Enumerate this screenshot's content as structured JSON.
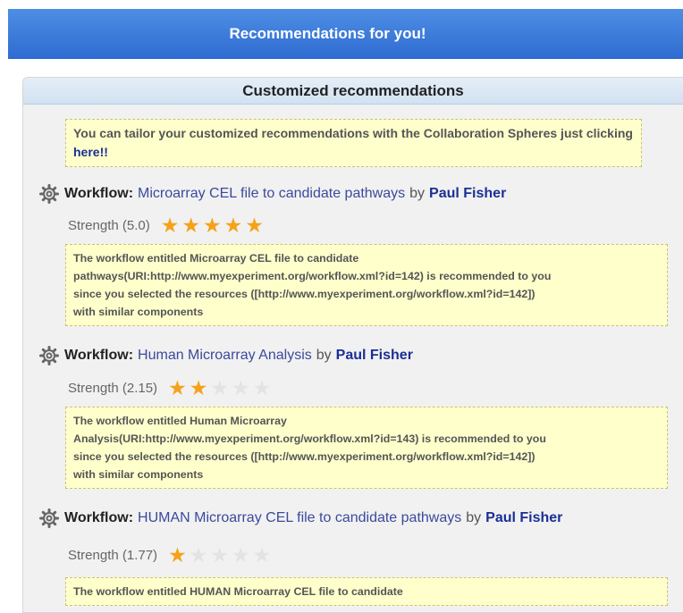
{
  "header": {
    "title": "Recommendations for you!"
  },
  "panel": {
    "title": "Customized recommendations",
    "note": {
      "text": "You can tailor your customized recommendations with the Collaboration Spheres just clicking ",
      "link": "here!!"
    }
  },
  "recommendations": [
    {
      "label": "Workflow:",
      "title": "Microarray CEL file to candidate pathways",
      "by": "by",
      "author": "Paul Fisher",
      "strength_text": "Strength (5.0)",
      "rating": 5,
      "max_rating": 5,
      "description_lines": [
        "The workflow entitled Microarray CEL file to candidate",
        "pathways(URI:http://www.myexperiment.org/workflow.xml?id=142) is recommended to you",
        "since you selected the resources ([http://www.myexperiment.org/workflow.xml?id=142])",
        "with similar components"
      ]
    },
    {
      "label": "Workflow:",
      "title": "Human Microarray Analysis",
      "by": "by",
      "author": "Paul Fisher",
      "strength_text": "Strength (2.15)",
      "rating": 2,
      "max_rating": 5,
      "description_lines": [
        "The workflow entitled Human Microarray",
        "Analysis(URI:http://www.myexperiment.org/workflow.xml?id=143) is recommended to you",
        "since you selected the resources ([http://www.myexperiment.org/workflow.xml?id=142])",
        "with similar components"
      ]
    },
    {
      "label": "Workflow:",
      "title": "HUMAN Microarray CEL file to candidate pathways",
      "by": "by",
      "author": "Paul Fisher",
      "strength_text": "Strength (1.77)",
      "rating": 1,
      "max_rating": 5,
      "description_lines": [
        "The workflow entitled HUMAN Microarray CEL file to candidate"
      ]
    }
  ],
  "icons": {
    "workflow": "gear-icon",
    "rating": "star-icon"
  },
  "colors": {
    "header_bar": "#3a7bdc",
    "star_on": "#f5a21b",
    "star_off": "#e3e3e3",
    "link": "#1a2f96",
    "note_bg": "#ffffcc"
  }
}
